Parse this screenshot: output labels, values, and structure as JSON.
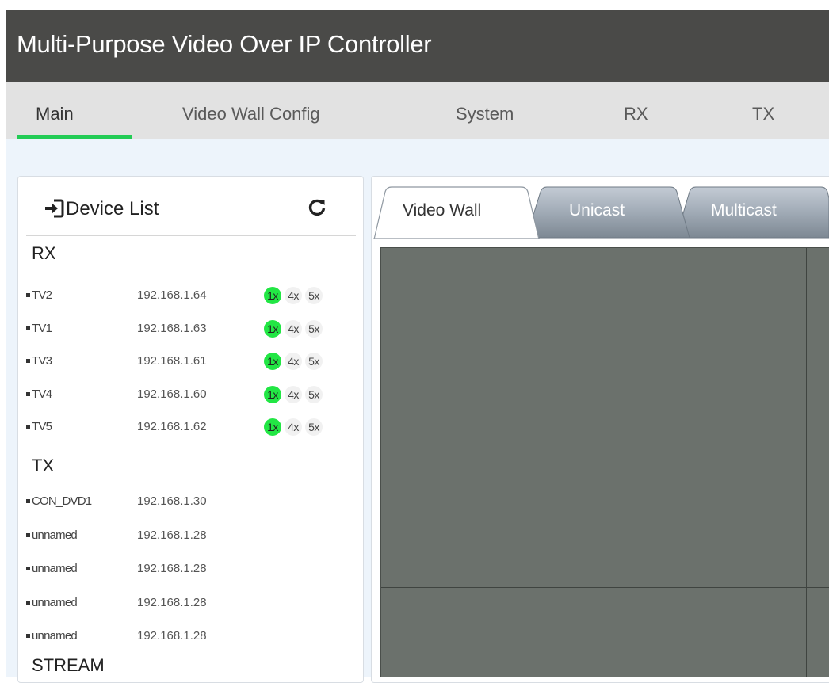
{
  "header": {
    "title": "Multi-Purpose Video Over IP Controller"
  },
  "nav": {
    "tabs": [
      {
        "label": "Main"
      },
      {
        "label": "Video Wall Config"
      },
      {
        "label": "System"
      },
      {
        "label": "RX"
      },
      {
        "label": "TX"
      }
    ],
    "active_color": "#22cc55"
  },
  "device_panel": {
    "title": "Device List",
    "sections": {
      "rx": "RX",
      "tx": "TX",
      "stream": "STREAM"
    },
    "rx_devices": [
      {
        "name": "TV2",
        "ip": "192.168.1.64",
        "scales": [
          "1x",
          "4x",
          "5x"
        ],
        "active": "1x"
      },
      {
        "name": "TV1",
        "ip": "192.168.1.63",
        "scales": [
          "1x",
          "4x",
          "5x"
        ],
        "active": "1x"
      },
      {
        "name": "TV3",
        "ip": "192.168.1.61",
        "scales": [
          "1x",
          "4x",
          "5x"
        ],
        "active": "1x"
      },
      {
        "name": "TV4",
        "ip": "192.168.1.60",
        "scales": [
          "1x",
          "4x",
          "5x"
        ],
        "active": "1x"
      },
      {
        "name": "TV5",
        "ip": "192.168.1.62",
        "scales": [
          "1x",
          "4x",
          "5x"
        ],
        "active": "1x"
      }
    ],
    "tx_devices": [
      {
        "name": "CON_DVD1",
        "ip": "192.168.1.30"
      },
      {
        "name": "unnamed",
        "ip": "192.168.1.28"
      },
      {
        "name": "unnamed",
        "ip": "192.168.1.28"
      },
      {
        "name": "unnamed",
        "ip": "192.168.1.28"
      },
      {
        "name": "unnamed",
        "ip": "192.168.1.28"
      }
    ],
    "icons": {
      "title_icon": "sign-in-icon",
      "refresh": "refresh-icon"
    },
    "active_scale_color": "#22e644"
  },
  "view_tabs": [
    {
      "label": "Video Wall",
      "active": true
    },
    {
      "label": "Unicast",
      "active": false
    },
    {
      "label": "Multicast",
      "active": false
    }
  ],
  "colors": {
    "header_bg": "#4a4a48",
    "wall_bg": "#6b716c"
  }
}
